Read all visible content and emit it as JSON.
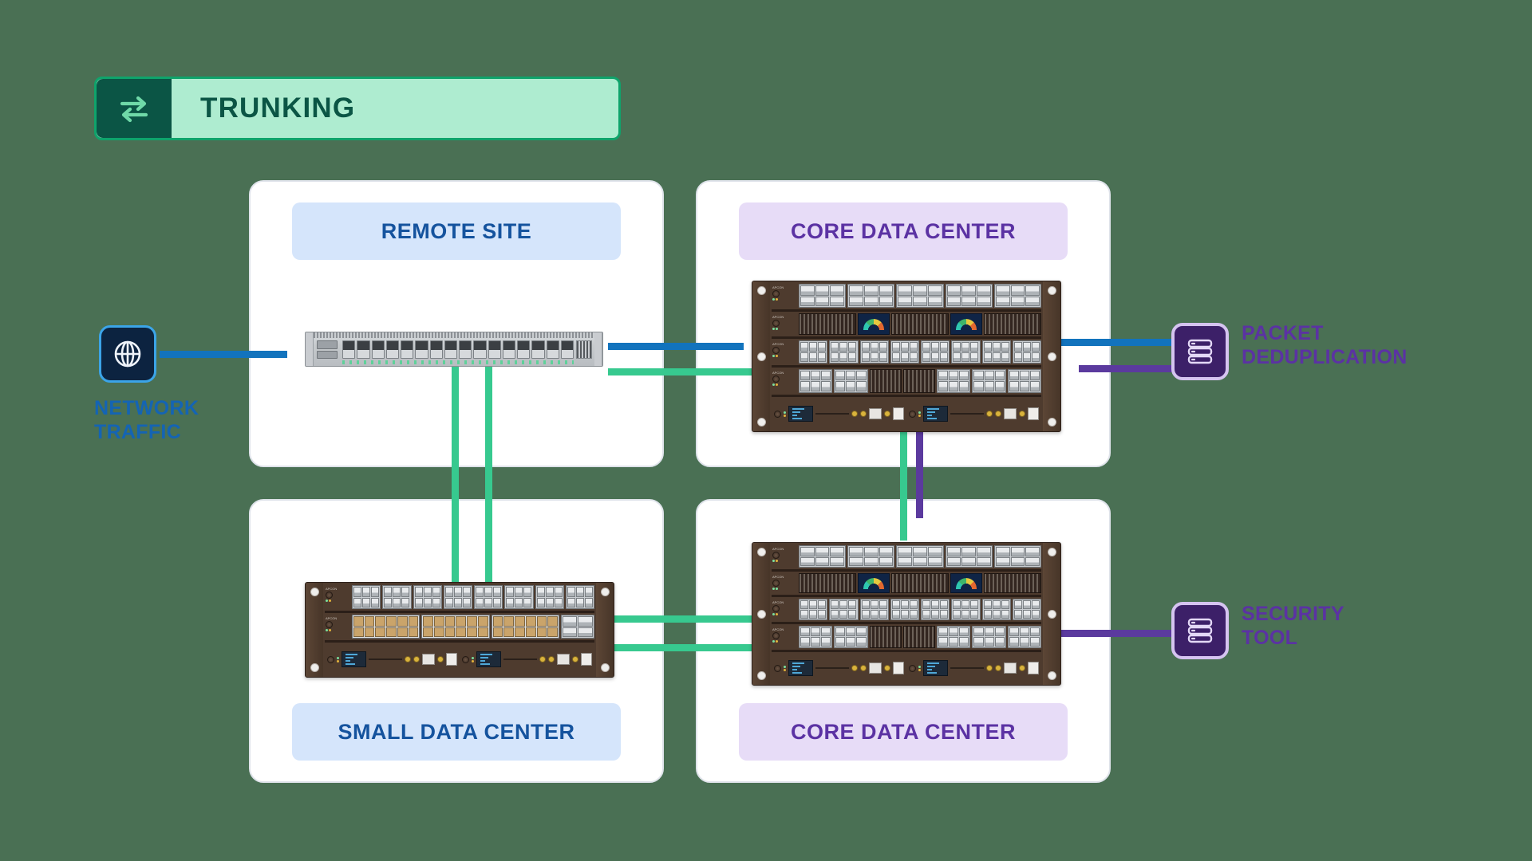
{
  "background_color": "#4a7054",
  "badge": {
    "label": "TRUNKING",
    "icon": "trunking-exchange-arrows-icon",
    "bg_color": "#aeecd0",
    "border_color": "#0fa36b",
    "icon_bg_color": "#0b5545",
    "text_color": "#0b5545"
  },
  "panels": {
    "remote_site": {
      "title": "REMOTE SITE",
      "title_position": "top",
      "pill_bg": "#d5e5fb",
      "pill_text": "#15539e"
    },
    "core_top": {
      "title": "CORE DATA CENTER",
      "title_position": "top",
      "pill_bg": "#e7dcf7",
      "pill_text": "#5b32a3"
    },
    "small_dc": {
      "title": "SMALL DATA CENTER",
      "title_position": "bottom",
      "pill_bg": "#d5e5fb",
      "pill_text": "#15539e"
    },
    "core_bottom": {
      "title": "CORE DATA CENTER",
      "title_position": "bottom",
      "pill_bg": "#e7dcf7",
      "pill_text": "#5b32a3"
    }
  },
  "endpoints": {
    "network_traffic": {
      "label_line1": "NETWORK",
      "label_line2": "TRAFFIC",
      "icon": "globe-icon",
      "icon_bg": "#0c2340",
      "icon_border": "#3ba4e8",
      "text_color": "#1464b4"
    },
    "packet_deduplication": {
      "label_line1": "PACKET",
      "label_line2": "DEDUPLICATION",
      "icon": "server-stack-icon",
      "icon_bg": "#3c2068",
      "icon_border": "#d5c3f0",
      "text_color": "#5b32a3"
    },
    "security_tool": {
      "label_line1": "SECURITY",
      "label_line2": "TOOL",
      "icon": "server-stack-icon",
      "icon_bg": "#3c2068",
      "icon_border": "#d5c3f0",
      "text_color": "#5b32a3"
    }
  },
  "devices": {
    "remote_switch": {
      "name": "1U network switch",
      "type": "pizza-box-switch",
      "port_count": 16
    },
    "core_top_chassis": {
      "name": "Core data center chassis",
      "type": "modular-chassis",
      "slots": [
        "D",
        "C",
        "B",
        "A"
      ]
    },
    "small_dc_chassis": {
      "name": "Small data center chassis",
      "type": "modular-chassis",
      "slots": [
        "B",
        "A"
      ]
    },
    "core_bot_chassis": {
      "name": "Core data center chassis",
      "type": "modular-chassis",
      "slots": [
        "D",
        "C",
        "B",
        "A"
      ]
    }
  },
  "connections": {
    "colors": {
      "traffic_blue": "#1273bd",
      "trunk_green": "#37c98f",
      "tool_purple": "#5b3a9e"
    },
    "links": [
      {
        "id": "traffic-to-remote",
        "from": "network-traffic",
        "to": "remote-switch",
        "color": "traffic_blue",
        "arrow": "right"
      },
      {
        "id": "remote-to-core-top",
        "from": "remote-switch",
        "to": "core-top-chassis",
        "color": "traffic_blue",
        "arrow": "right"
      },
      {
        "id": "remote-trunk-to-core-top",
        "from": "remote-switch",
        "to": "core-top-chassis",
        "color": "trunk_green",
        "arrow": "none"
      },
      {
        "id": "remote-trunk-to-small-1",
        "from": "remote-switch",
        "to": "small-dc-chassis",
        "color": "trunk_green",
        "arrow": "none"
      },
      {
        "id": "remote-trunk-to-small-2",
        "from": "remote-switch",
        "to": "small-dc-chassis",
        "color": "trunk_green",
        "arrow": "none"
      },
      {
        "id": "core-top-to-dedup",
        "from": "core-top-chassis",
        "to": "packet-deduplication",
        "color": "traffic_blue",
        "arrow": "right"
      },
      {
        "id": "dedup-to-core-top",
        "from": "packet-deduplication",
        "to": "core-top-chassis",
        "color": "tool_purple",
        "arrow": "left"
      },
      {
        "id": "core-top-trunk-to-bot",
        "from": "core-top-chassis",
        "to": "core-bot-chassis",
        "color": "trunk_green",
        "arrow": "none"
      },
      {
        "id": "core-top-tool-to-bot",
        "from": "core-top-chassis",
        "to": "core-bot-chassis",
        "color": "tool_purple",
        "arrow": "down"
      },
      {
        "id": "small-to-core-bot-1",
        "from": "small-dc-chassis",
        "to": "core-bot-chassis",
        "color": "trunk_green",
        "arrow": "none"
      },
      {
        "id": "small-to-core-bot-2",
        "from": "small-dc-chassis",
        "to": "core-bot-chassis",
        "color": "trunk_green",
        "arrow": "none"
      },
      {
        "id": "core-bot-to-security",
        "from": "core-bot-chassis",
        "to": "security-tool",
        "color": "tool_purple",
        "arrow": "right"
      }
    ]
  }
}
